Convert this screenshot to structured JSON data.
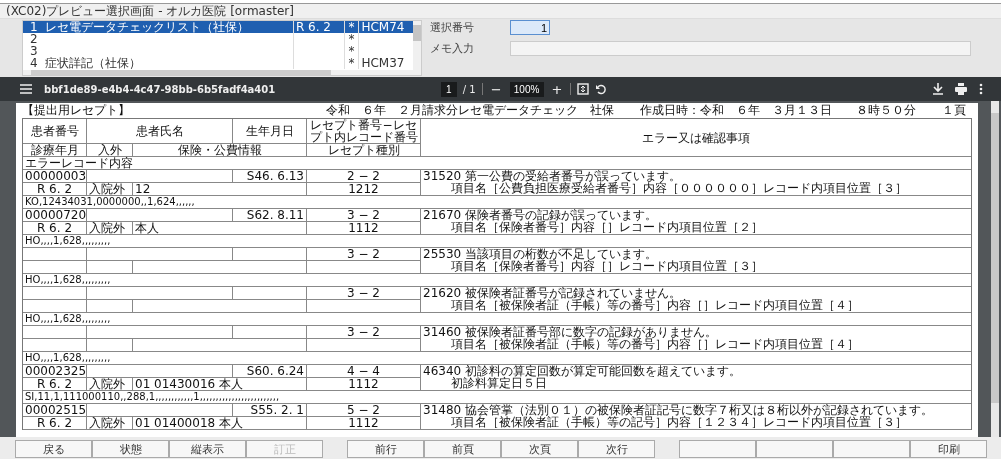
{
  "window": {
    "title": "(XC02)プレビュー選択画面 - オルカ医院 [ormaster]"
  },
  "list": {
    "rows": [
      {
        "no": "1",
        "name": "レセ電データチェックリスト（社保）",
        "period": "R 6. 2",
        "mark": "*",
        "code": "HCM74",
        "selected": true
      },
      {
        "no": "2",
        "mark": "*",
        "selected": false
      },
      {
        "no": "3",
        "mark": "*",
        "selected": false
      },
      {
        "no": "4",
        "name": "症状詳記（社保）",
        "mark": "*",
        "code": "HCM37",
        "selected": false
      }
    ]
  },
  "selection_number": {
    "label": "選択番号",
    "value": "1"
  },
  "memo": {
    "label": "メモ入力"
  },
  "viewer": {
    "file_name": "bbf1de89-e4b4-4c47-98bb-6b5fadf4a401",
    "page": "1",
    "page_total": "/ 1",
    "zoom_out": "−",
    "zoom": "100%",
    "zoom_in": "+"
  },
  "document": {
    "title": "令和　６年　２月請求分レセ電データチェック　社保",
    "created": "作成日時：令和　６年　３月１３日　　８時５０分",
    "page_no": "１頁",
    "section": "【提出用レセプト】",
    "header_top": [
      "患者番号",
      "患者氏名",
      "生年月日",
      "レセプト番号−レセプト内レコード番号",
      "エラー又は確認事項"
    ],
    "header_bottom": [
      "診療年月",
      "入外",
      "保険・公費情報",
      "レセプト種別"
    ],
    "error_heading": "エラーレコード内容",
    "records": [
      {
        "patient_no": "00000003",
        "birth": "S46. 6.13",
        "receipt_no": "2 − 2",
        "month": "R 6. 2",
        "visit": "入院外",
        "insurance": "12",
        "type": "1212",
        "error": "31520 第一公費の受給者番号が誤っています。",
        "detail": "項目名［公費負担医療受給者番号］内容［００００００］レコード内項目位置［３］",
        "data": "KO,12434031,0000000,,1,624,,,,,,"
      },
      {
        "patient_no": "00000720",
        "birth": "S62. 8.11",
        "receipt_no": "3 − 2",
        "month": "R 6. 2",
        "visit": "入院外",
        "insurance": "本人",
        "type": "1112",
        "error": "21670 保険者番号の記録が誤っています。",
        "detail": "項目名［保険者番号］内容［］レコード内項目位置［２］",
        "data": "HO,,,,1,628,,,,,,,,,"
      },
      {
        "receipt_no": "3 − 2",
        "error": "25530 当該項目の桁数が不足しています。",
        "detail": "項目名［保険者番号］内容［］レコード内項目位置［３］",
        "data": "HO,,,,1,628,,,,,,,,,"
      },
      {
        "receipt_no": "3 − 2",
        "error": "21620 被保険者証番号が記録されていません。",
        "detail": "項目名［被保険者証（手帳）等の番号］内容［］レコード内項目位置［４］",
        "data": "HO,,,,1,628,,,,,,,,,"
      },
      {
        "receipt_no": "3 − 2",
        "error": "31460 被保険者証番号部に数字の記録がありません。",
        "detail": "項目名［被保険者証（手帳）等の番号］内容［］レコード内項目位置［４］",
        "data": "HO,,,,1,628,,,,,,,,,"
      },
      {
        "patient_no": "00002325",
        "birth": "S60. 6.24",
        "receipt_no": "4 − 4",
        "month": "R 6. 2",
        "visit": "入院外",
        "insurance": "01 01430016 本人",
        "type": "1112",
        "error": "46340 初診料の算定回数が算定可能回数を超えています。",
        "detail": "初診料算定日５日",
        "data": "SI,11,1,111000110,,288,1,,,,,,,,,,,,1,,,,,,,,,,,,,,,,,,,,,,,,,"
      },
      {
        "patient_no": "00002515",
        "birth": "S55. 2. 1",
        "receipt_no": "5 − 2",
        "month": "R 6. 2",
        "visit": "入院外",
        "insurance": "01 01400018 本人",
        "type": "1112",
        "error": "31480 協会管掌（法別０１）の被保険者証記号に数字７桁又は８桁以外が記録されています。",
        "detail": "項目名［被保険者証（手帳）等の記号］内容［１２３４］レコード内項目位置［３］"
      }
    ]
  },
  "button_groups": [
    [
      {
        "kind": "action",
        "label": "戻る",
        "disabled": false
      },
      {
        "kind": "action",
        "label": "状態",
        "disabled": false
      },
      {
        "kind": "action",
        "label": "縦表示",
        "disabled": false
      },
      {
        "kind": "action",
        "label": "訂正",
        "disabled": true
      }
    ],
    [
      {
        "kind": "action",
        "label": "前行",
        "disabled": false
      },
      {
        "kind": "action",
        "label": "前頁",
        "disabled": false
      },
      {
        "kind": "action",
        "label": "次頁",
        "disabled": false
      },
      {
        "kind": "action",
        "label": "次行",
        "disabled": false
      }
    ],
    [
      {
        "kind": "blank"
      },
      {
        "kind": "blank"
      },
      {
        "kind": "blank"
      },
      {
        "kind": "action",
        "label": "印刷",
        "disabled": false
      }
    ]
  ]
}
